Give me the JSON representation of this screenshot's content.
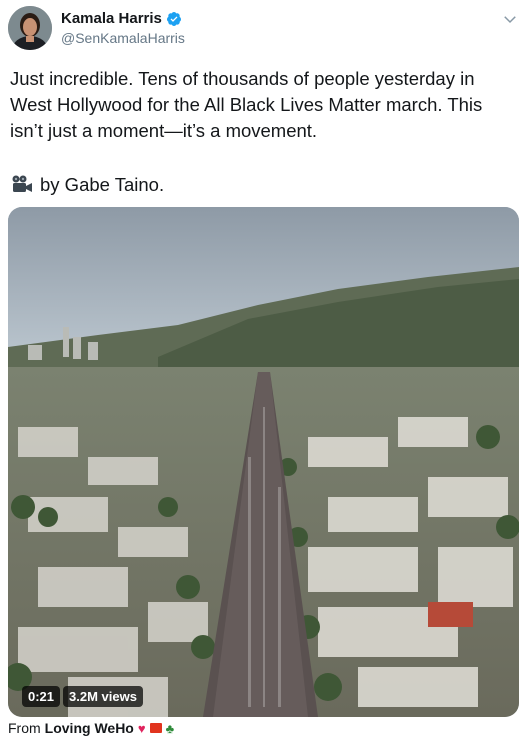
{
  "tweet": {
    "author": {
      "display_name": "Kamala Harris",
      "handle": "@SenKamalaHarris",
      "verified": true
    },
    "text": "Just incredible. Tens of thousands of people yesterday in West Hollywood for the All Black Lives Matter march. This isn’t just a moment—it’s a movement.",
    "credit_text": "by Gabe Taino.",
    "media": {
      "type": "video",
      "duration": "0:21",
      "views": "3.2M views"
    },
    "from": {
      "prefix": "From",
      "source": "Loving WeHo"
    }
  },
  "icons": {
    "verified": "verified-badge-icon",
    "menu": "chevron-down-icon",
    "camera": "movie-camera-icon"
  },
  "colors": {
    "verified": "#1da1f2",
    "handle": "#657786",
    "text": "#14171a"
  }
}
